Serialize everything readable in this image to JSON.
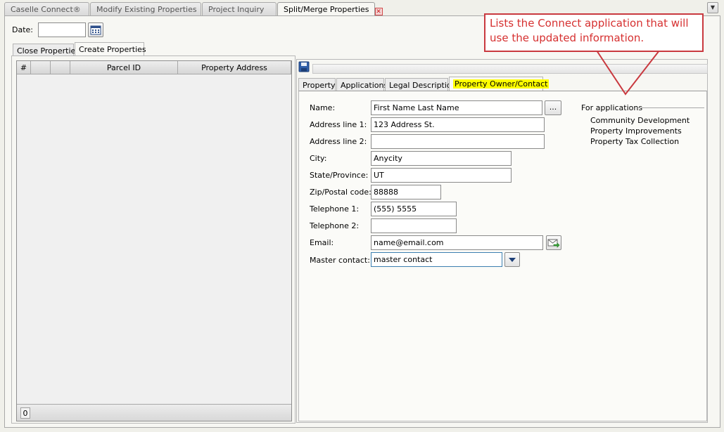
{
  "top_tabs": [
    {
      "label": "Caselle Connect®"
    },
    {
      "label": "Modify Existing Properties"
    },
    {
      "label": "Project Inquiry"
    },
    {
      "label": "Split/Merge Properties"
    }
  ],
  "date": {
    "label": "Date:",
    "value": ""
  },
  "left_tabs": [
    {
      "label": "Close Properties"
    },
    {
      "label": "Create Properties"
    }
  ],
  "grid": {
    "columns": [
      "#",
      "",
      "",
      "Parcel ID",
      "Property Address"
    ],
    "footer_count": "0"
  },
  "detail_tabs": [
    {
      "label": "Property"
    },
    {
      "label": "Applications"
    },
    {
      "label": "Legal Description"
    },
    {
      "label": "Property Owner/Contact"
    }
  ],
  "form": {
    "name_label": "Name:",
    "name_value": "First Name Last Name",
    "browse_label": "...",
    "address1_label": "Address line 1:",
    "address1_value": "123 Address St.",
    "address2_label": "Address line 2:",
    "address2_value": "",
    "city_label": "City:",
    "city_value": "Anycity",
    "state_label": "State/Province:",
    "state_value": "UT",
    "zip_label": "Zip/Postal code:",
    "zip_value": "88888",
    "phone1_label": "Telephone 1:",
    "phone1_value": "(555) 5555",
    "phone2_label": "Telephone 2:",
    "phone2_value": "",
    "email_label": "Email:",
    "email_value": "name@email.com",
    "master_label": "Master contact:",
    "master_value": "master contact"
  },
  "applications": {
    "heading": "For applications",
    "items": [
      "Community Development",
      "Property Improvements",
      "Property Tax Collection"
    ]
  },
  "callout": {
    "text": "Lists the Connect application that will use the updated information."
  },
  "colors": {
    "callout_border": "#c9393f",
    "callout_text": "#d63030",
    "highlight_tab": "#ffff00"
  }
}
